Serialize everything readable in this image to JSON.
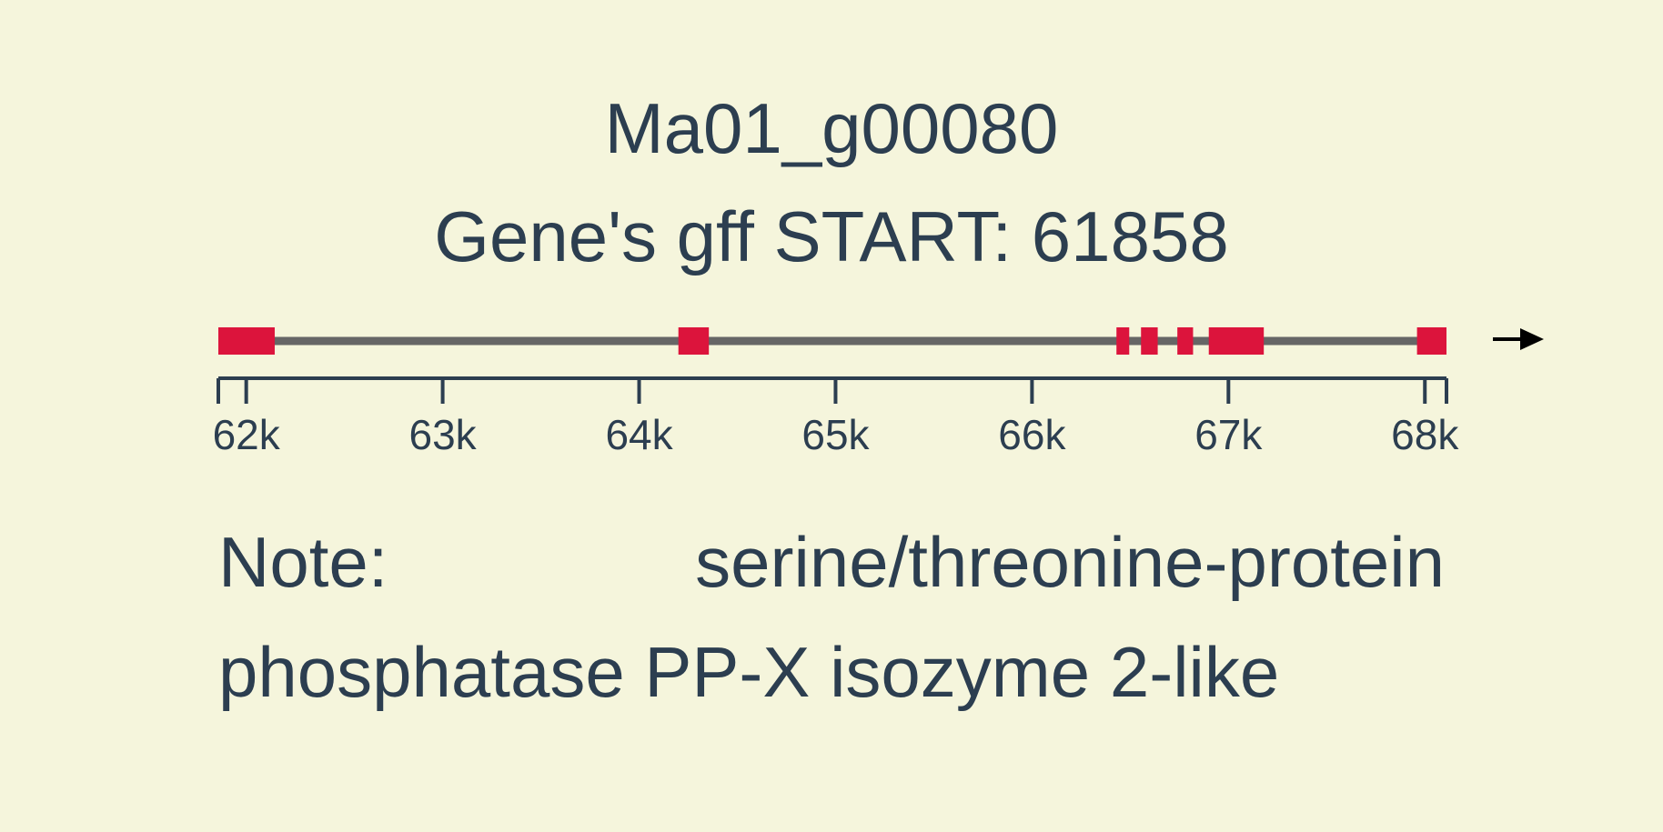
{
  "gene": {
    "id": "Ma01_g00080",
    "start_label": "Gene's gff START: 61858"
  },
  "colors": {
    "background": "#f5f5dc",
    "exon": "#dc143c",
    "intron": "#666666",
    "axis": "#2c3e50",
    "text": "#2c3e50",
    "arrow": "#000000"
  },
  "chart_data": {
    "type": "gene-structure",
    "strand": "+",
    "strand_icon": "arrow-right-icon",
    "axis": {
      "range": [
        61858,
        68110
      ],
      "ticks": [
        {
          "value": 62000,
          "label": "62k"
        },
        {
          "value": 63000,
          "label": "63k"
        },
        {
          "value": 64000,
          "label": "64k"
        },
        {
          "value": 65000,
          "label": "65k"
        },
        {
          "value": 66000,
          "label": "66k"
        },
        {
          "value": 67000,
          "label": "67k"
        },
        {
          "value": 68000,
          "label": "68k"
        }
      ]
    },
    "exons": [
      {
        "start": 61858,
        "end": 62145
      },
      {
        "start": 64200,
        "end": 64355
      },
      {
        "start": 66430,
        "end": 66495
      },
      {
        "start": 66555,
        "end": 66640
      },
      {
        "start": 66740,
        "end": 66820
      },
      {
        "start": 66900,
        "end": 67180
      },
      {
        "start": 67960,
        "end": 68110
      }
    ]
  },
  "note": {
    "label": "Note:",
    "line1_text": "serine/threonine-protein",
    "line2_text": "phosphatase PP-X isozyme 2-like"
  }
}
